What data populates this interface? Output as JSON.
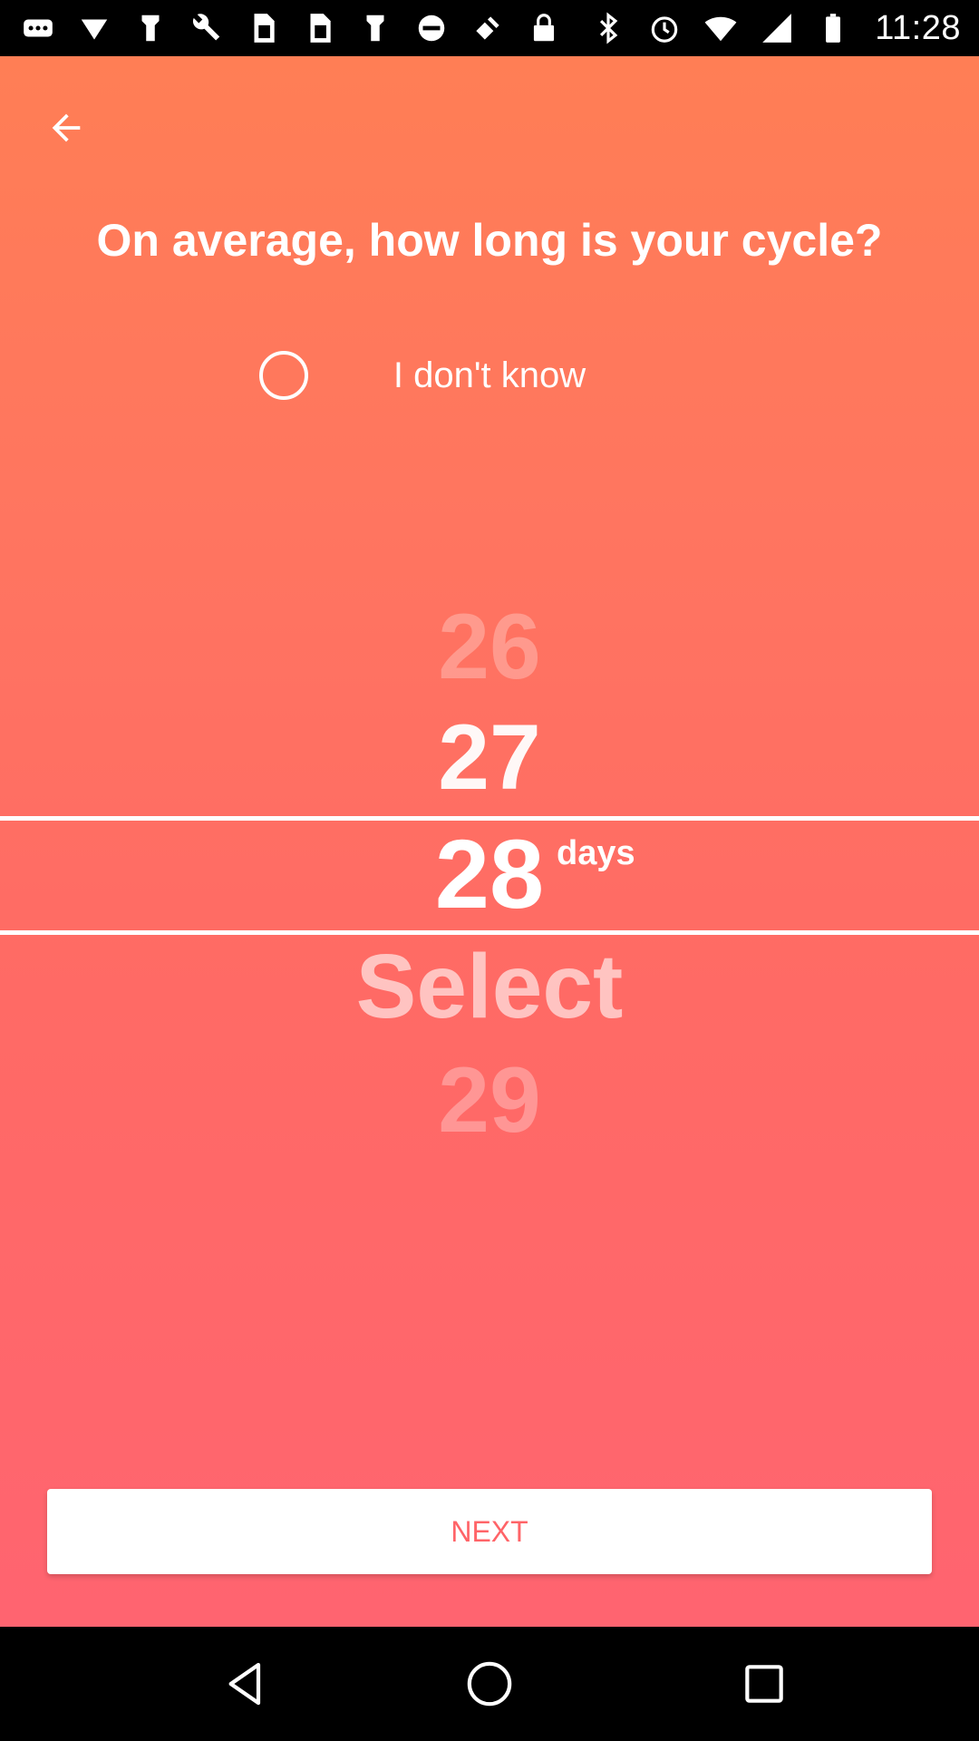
{
  "status_bar": {
    "time": "11:28",
    "left_icons": [
      "more-icon",
      "dropdown-icon",
      "flash-icon",
      "wrench-icon",
      "sim-icon",
      "sim-icon",
      "flash-icon",
      "block-icon",
      "fake-gps-icon",
      "lock-icon"
    ],
    "right_icons": [
      "bluetooth-icon",
      "alarm-icon",
      "wifi-icon",
      "signal-icon",
      "battery-icon"
    ]
  },
  "screen": {
    "question": "On average, how long is your cycle?",
    "unknown_option": "I don't know",
    "picker": {
      "items": [
        "26",
        "27",
        "28",
        "Select",
        "29"
      ],
      "selected": "28",
      "unit": "days"
    },
    "next_label": "NEXT"
  },
  "colors": {
    "gradient_top": "#FF7E55",
    "gradient_bottom": "#FF6470",
    "button_text": "#FF6468"
  }
}
